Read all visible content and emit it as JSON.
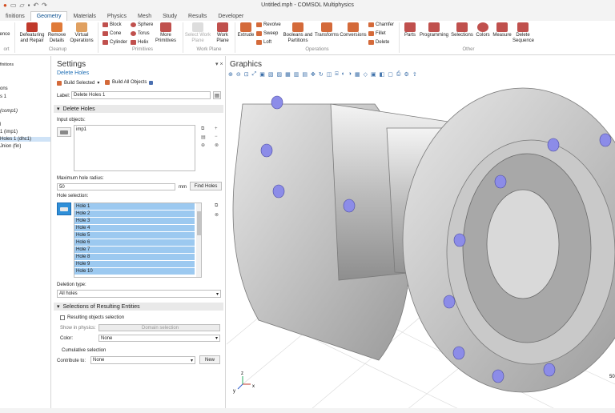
{
  "window": {
    "title": "Untitled.mph - COMSOL Multiphysics"
  },
  "tabs": [
    {
      "label": "finitions"
    },
    {
      "label": "Geometry"
    },
    {
      "label": "Materials"
    },
    {
      "label": "Physics"
    },
    {
      "label": "Mesh"
    },
    {
      "label": "Study"
    },
    {
      "label": "Results"
    },
    {
      "label": "Developer"
    }
  ],
  "ribbon": {
    "ence": "ence",
    "defeaturing": "Defeaturing\nand Repair",
    "remove_details": "Remove\nDetails",
    "virtual_ops": "Virtual\nOperations",
    "block": "Block",
    "cone": "Cone",
    "cylinder": "Cylinder",
    "sphere": "Sphere",
    "torus": "Torus",
    "helix": "Helix",
    "more_primitives": "More\nPrimitives",
    "select_work_plane": "Select Work\nPlane",
    "work_plane": "Work\nPlane",
    "extrude": "Extrude",
    "revolve": "Revolve",
    "sweep": "Sweep",
    "loft": "Loft",
    "booleans": "Booleans and\nPartitions",
    "transforms": "Transforms",
    "conversions": "Conversions",
    "chamfer": "Chamfer",
    "fillet": "Fillet",
    "delete": "Delete",
    "parts": "Parts",
    "programming": "Programming",
    "selections": "Selections",
    "colors": "Colors",
    "measure": "Measure",
    "delete_sequence": "Delete\nSequence",
    "groups": {
      "ort": "ort",
      "cleanup": "Cleanup",
      "primitives": "Primitives",
      "work_plane": "Work Plane",
      "operations": "Operations",
      "other": "Other"
    }
  },
  "tree": [
    {
      "label": "finitions"
    },
    {
      "label": "ons"
    },
    {
      "label": "s 1"
    },
    {
      "label": "(comp1)"
    },
    {
      "label": "l"
    },
    {
      "label": "1 (imp1)"
    },
    {
      "label": "Holes 1 (dhc1)",
      "selected": true
    },
    {
      "label": "Jnion (fin)"
    }
  ],
  "settings": {
    "header": "Settings",
    "subheader": "Delete Holes",
    "build_selected": "Build Selected",
    "build_all": "Build All Objects",
    "label_caption": "Label:",
    "label_value": "Delete Holes 1",
    "section_delete": "Delete Holes",
    "input_objects": "Input objects:",
    "input_item": "imp1",
    "max_radius": "Maximum hole radius:",
    "max_radius_value": "50",
    "unit": "mm",
    "find_holes": "Find Holes",
    "hole_selection": "Hole selection:",
    "holes": [
      "Hole 1",
      "Hole 2",
      "Hole 3",
      "Hole 4",
      "Hole 5",
      "Hole 6",
      "Hole 7",
      "Hole 8",
      "Hole 9",
      "Hole 10"
    ],
    "deletion_type": "Deletion type:",
    "deletion_value": "All holes",
    "section_selections": "Selections of Resulting Entities",
    "resulting_objects": "Resulting objects selection",
    "show_in_physics": "Show in physics:",
    "domain_selection": "Domain selection",
    "color": "Color:",
    "color_value": "None",
    "cumulative": "Cumulative selection",
    "contribute": "Contribute to:",
    "contribute_value": "None",
    "new": "New"
  },
  "graphics": {
    "title": "Graphics",
    "scale_label": "50"
  },
  "colors": {
    "accent": "#0a4f8f",
    "selection": "#9cc9f0",
    "hole": "#8c8ce8"
  }
}
